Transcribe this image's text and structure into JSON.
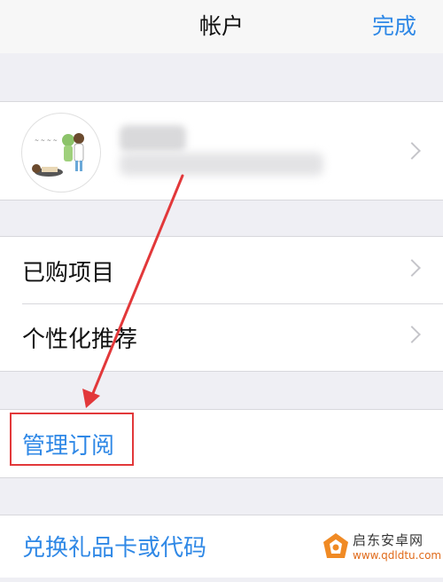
{
  "navbar": {
    "title": "帐户",
    "done_label": "完成"
  },
  "account": {
    "avatar_icon": "avatar-cartoon-icon",
    "name_blurred": true,
    "email_blurred": true
  },
  "menu": {
    "purchases_label": "已购项目",
    "personalized_label": "个性化推荐",
    "manage_subscriptions_label": "管理订阅",
    "redeem_label": "兑换礼品卡或代码"
  },
  "annotation": {
    "highlight_color": "#e2383a",
    "arrow_color": "#e2383a"
  },
  "watermark": {
    "title": "启东安卓网",
    "url": "www.qdldtu.com"
  },
  "colors": {
    "accent": "#2f88e6",
    "background": "#efeff4"
  }
}
